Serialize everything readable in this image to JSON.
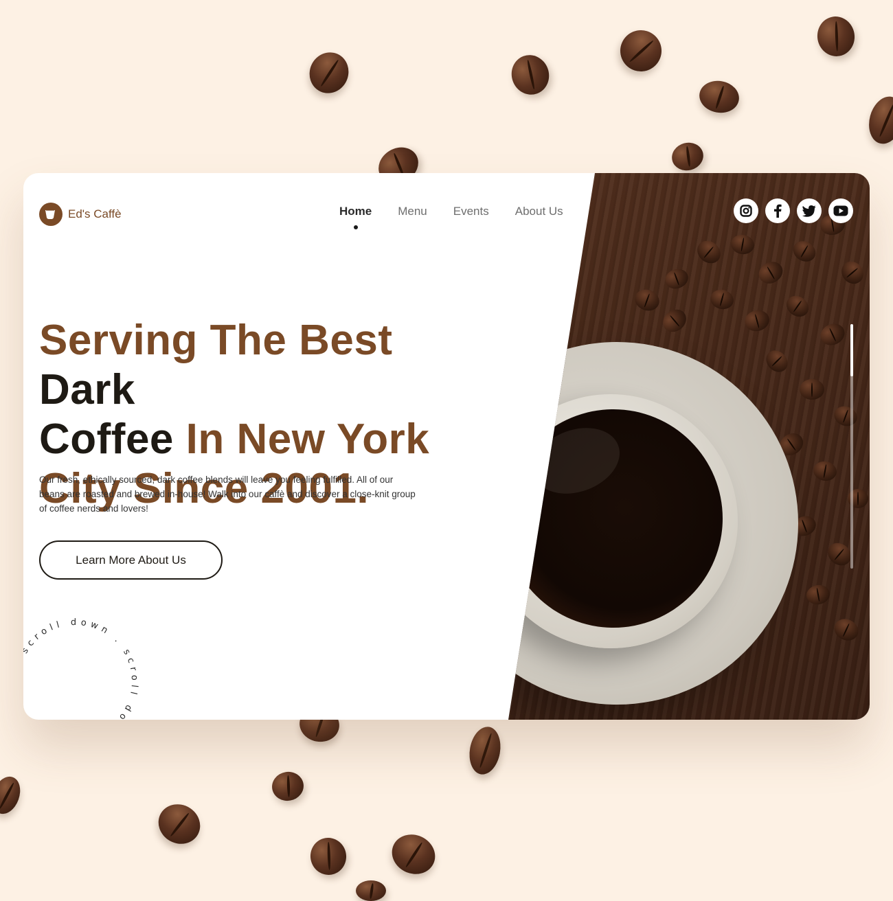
{
  "brand": {
    "name": "Ed's Caffè",
    "logo_icon": "coffee-cup-icon",
    "accent": "#7a4a26"
  },
  "nav": {
    "items": [
      {
        "label": "Home",
        "active": true
      },
      {
        "label": "Menu",
        "active": false
      },
      {
        "label": "Events",
        "active": false
      },
      {
        "label": "About Us",
        "active": false
      }
    ]
  },
  "social": [
    "instagram-icon",
    "facebook-icon",
    "twitter-icon",
    "youtube-icon"
  ],
  "hero": {
    "headline_parts": [
      {
        "text": "Serving The Best ",
        "tone": "brown"
      },
      {
        "text": "Dark",
        "tone": "dark"
      },
      {
        "text": "Coffee",
        "tone": "dark"
      },
      {
        "text": " In New York",
        "tone": "brown"
      },
      {
        "text": "City Since 2001.",
        "tone": "brown"
      }
    ],
    "description": "Our fresh, ethically sourced, dark coffee blends will leave you feeling fulfilled. All of our beans are roasted and brewed in-house! Walk into our caffè and discover a close-knit group of coffee nerds and lovers!",
    "cta_label": "Learn More About Us"
  },
  "scroll_indicator": {
    "text": "scroll down . scroll down . "
  },
  "colors": {
    "background": "#fdf1e4",
    "brown": "#7a4a26",
    "dark": "#1e1a14"
  }
}
